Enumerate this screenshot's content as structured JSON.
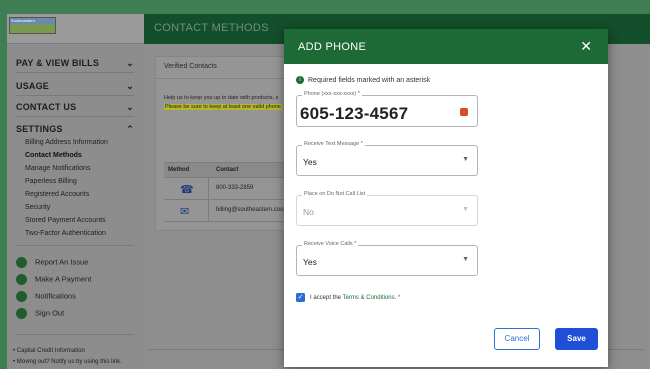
{
  "brand": {
    "logo_text": "Southeastern"
  },
  "sidebar": {
    "sections": [
      {
        "label": "PAY & VIEW BILLS",
        "chevron": "chevron-down"
      },
      {
        "label": "USAGE",
        "chevron": "chevron-down"
      },
      {
        "label": "CONTACT US",
        "chevron": "chevron-down"
      },
      {
        "label": "SETTINGS",
        "chevron": "chevron-up"
      }
    ],
    "settings_items": [
      "Billing Address Information",
      "Contact Methods",
      "Manage Notifications",
      "Paperless Billing",
      "Registered Accounts",
      "Security",
      "Stored Payment Accounts",
      "Two-Factor Authentication"
    ],
    "actions": [
      "Report An Issue",
      "Make A Payment",
      "Notifications",
      "Sign Out"
    ],
    "footer_links": [
      "Capital Credit Information",
      "Moving out? Notify us by using this link."
    ]
  },
  "header": {
    "title": "CONTACT METHODS"
  },
  "card": {
    "title": "Verified Contacts",
    "help_text": "Help us to keep you up to date with products, s",
    "warning_text": "Please be sure to keep at least one valid phone",
    "table": {
      "headers": [
        "Method",
        "Contact"
      ],
      "rows": [
        {
          "icon": "phone-icon",
          "contact": "800-333-2859"
        },
        {
          "icon": "email-icon",
          "contact": "billing@southeastern.coop"
        }
      ]
    }
  },
  "modal": {
    "title": "ADD PHONE",
    "close_glyph": "✕",
    "required_note": "Required fields marked with an asterisk",
    "phone": {
      "label": "Phone (xxx-xxx-xxxx)",
      "value": "605-123-4567"
    },
    "text_message": {
      "label": "Receive Text Message",
      "value": "Yes"
    },
    "do_not_call": {
      "label": "Place on Do Not Call List",
      "value": "No"
    },
    "voice_calls": {
      "label": "Receive Voice Calls",
      "value": "Yes"
    },
    "terms": {
      "prefix": "I accept the",
      "link": "Terms & Conditions.",
      "checked": true
    },
    "cancel_label": "Cancel",
    "save_label": "Save"
  },
  "colors": {
    "header_green": "#1e6a37",
    "dark_green": "#134f2a",
    "primary_blue": "#1f4fd6",
    "required_red": "#cc3333"
  }
}
